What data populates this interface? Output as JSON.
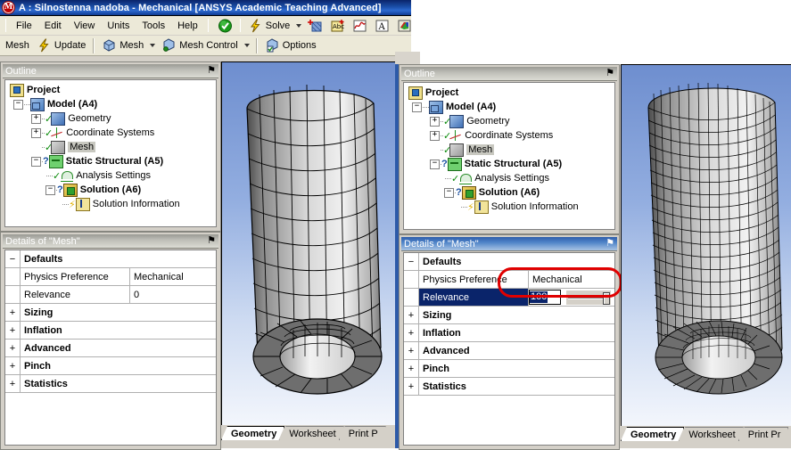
{
  "window": {
    "title": "A : Silnostenna nadoba - Mechanical [ANSYS Academic Teaching Advanced]",
    "logo_glyph": "M"
  },
  "menubar": {
    "items": [
      {
        "label": "File"
      },
      {
        "label": "Edit"
      },
      {
        "label": "View"
      },
      {
        "label": "Units"
      },
      {
        "label": "Tools"
      },
      {
        "label": "Help"
      }
    ]
  },
  "standard_toolbar": {
    "solve_label": "Solve",
    "icons": [
      {
        "name": "green-check-icon",
        "glyph": "✔"
      },
      {
        "name": "solve-lightning-icon",
        "glyph": "⚡"
      },
      {
        "name": "new-section-plane-icon",
        "glyph": "+"
      },
      {
        "name": "annotation-abc-icon",
        "glyph": "Abc"
      },
      {
        "name": "chart-icon",
        "glyph": "〜"
      },
      {
        "name": "text-a-icon",
        "glyph": "A"
      },
      {
        "name": "color-cube-icon",
        "glyph": "■"
      }
    ]
  },
  "context_toolbar": {
    "items": [
      {
        "label": "Mesh",
        "icon": "mesh-label"
      },
      {
        "label": "Update",
        "icon": "update-lightning-icon"
      },
      {
        "label": "Mesh",
        "icon": "mesh-cube-icon",
        "dropdown": true
      },
      {
        "label": "Mesh Control",
        "icon": "mesh-control-icon",
        "dropdown": true
      },
      {
        "label": "Options",
        "icon": "options-icon"
      }
    ]
  },
  "outline": {
    "title": "Outline",
    "pin_glyph": "⚑",
    "tree": [
      {
        "label": "Project",
        "icon": "project-folder-icon",
        "bold": true,
        "indent": 0,
        "expander": "",
        "status": ""
      },
      {
        "label": "Model (A4)",
        "icon": "model-cube-icon",
        "bold": true,
        "indent": 1,
        "expander": "−",
        "status": ""
      },
      {
        "label": "Geometry",
        "icon": "geometry-icon",
        "bold": false,
        "indent": 2,
        "expander": "+",
        "status": "check"
      },
      {
        "label": "Coordinate Systems",
        "icon": "coordinate-systems-icon",
        "bold": false,
        "indent": 2,
        "expander": "+",
        "status": "check"
      },
      {
        "label": "Mesh",
        "icon": "mesh-icon",
        "bold": false,
        "indent": 2,
        "expander": "",
        "status": "check",
        "selected": true
      },
      {
        "label": "Static Structural (A5)",
        "icon": "static-structural-icon",
        "bold": true,
        "indent": 2,
        "expander": "−",
        "status": "question"
      },
      {
        "label": "Analysis Settings",
        "icon": "analysis-settings-icon",
        "bold": false,
        "indent": 3,
        "expander": "",
        "status": "check"
      },
      {
        "label": "Solution (A6)",
        "icon": "solution-icon",
        "bold": true,
        "indent": 3,
        "expander": "−",
        "status": "question"
      },
      {
        "label": "Solution Information",
        "icon": "solution-information-icon",
        "bold": false,
        "indent": 4,
        "expander": "",
        "status": "bolt"
      }
    ]
  },
  "details_left": {
    "title": "Details of \"Mesh\"",
    "pin_glyph": "⚑",
    "rows": [
      {
        "type": "category",
        "expander": "−",
        "label": "Defaults"
      },
      {
        "type": "property",
        "label": "Physics Preference",
        "value": "Mechanical"
      },
      {
        "type": "property",
        "label": "Relevance",
        "value": "0"
      },
      {
        "type": "category",
        "expander": "+",
        "label": "Sizing"
      },
      {
        "type": "category",
        "expander": "+",
        "label": "Inflation"
      },
      {
        "type": "category",
        "expander": "+",
        "label": "Advanced"
      },
      {
        "type": "category",
        "expander": "+",
        "label": "Pinch"
      },
      {
        "type": "category",
        "expander": "+",
        "label": "Statistics"
      }
    ]
  },
  "details_right": {
    "title": "Details of \"Mesh\"",
    "pin_glyph": "⚑",
    "rows": [
      {
        "type": "category",
        "expander": "−",
        "label": "Defaults"
      },
      {
        "type": "property",
        "label": "Physics Preference",
        "value": "Mechanical"
      },
      {
        "type": "editing",
        "label": "Relevance",
        "value": "100"
      },
      {
        "type": "category",
        "expander": "+",
        "label": "Sizing"
      },
      {
        "type": "category",
        "expander": "+",
        "label": "Inflation"
      },
      {
        "type": "category",
        "expander": "+",
        "label": "Advanced"
      },
      {
        "type": "category",
        "expander": "+",
        "label": "Pinch"
      },
      {
        "type": "category",
        "expander": "+",
        "label": "Statistics"
      }
    ],
    "highlight_color": "#e00000"
  },
  "viewport_tabs_left": [
    {
      "label": "Geometry",
      "active": true
    },
    {
      "label": "Worksheet",
      "active": false
    },
    {
      "label": "Print P",
      "active": false
    }
  ],
  "viewport_tabs_right": [
    {
      "label": "Geometry",
      "active": true
    },
    {
      "label": "Worksheet",
      "active": false
    },
    {
      "label": "Print Pr",
      "active": false
    }
  ],
  "viewport": {
    "model": "hollow-cylinder-mesh",
    "left_mesh": "coarse",
    "right_mesh": "fine"
  },
  "colors": {
    "titlebar": "#0a246a",
    "panel_face": "#d4d0c8",
    "selection": "#0a246a",
    "highlight": "#e00000",
    "viewport_sky": "#6e8ecf"
  }
}
